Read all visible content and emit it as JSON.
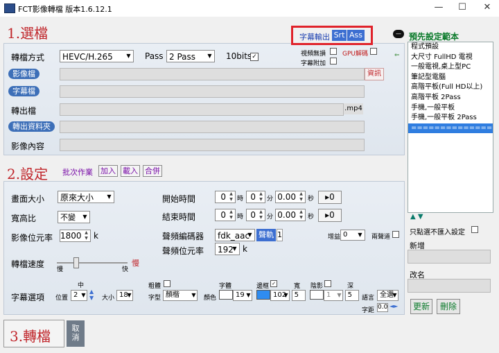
{
  "window": {
    "title": "FCT影像轉檔 版本1.6.12.1",
    "minimize": "—",
    "maximize": "☐",
    "close": "✕"
  },
  "section1": {
    "title": "1.選檔",
    "subtitle_output": "字幕輸出",
    "srt": "Srt",
    "ass": "Ass",
    "format_label": "轉檔方式",
    "format_value": "HEVC/H.265",
    "pass_label": "Pass",
    "pass_value": "2 Pass",
    "bits_label": "10bits",
    "bits_checked": "✓",
    "video_lossless": "視頻無損",
    "gpu_hw": "GPU解碼",
    "subtitle_attach": "字幕附加",
    "video_file": "影像檔",
    "info_button": "資訊",
    "subtitle_file": "字幕檔",
    "output_file": "轉出檔",
    "output_ext": ".mp4",
    "output_folder": "轉出資料夾",
    "video_content": "影像內容"
  },
  "section2": {
    "title": "2.設定",
    "batch": "批次作業",
    "add": "加入",
    "load": "載入",
    "merge": "合併",
    "size_label": "畫面大小",
    "size_value": "原來大小",
    "aspect_label": "寬高比",
    "aspect_value": "不變",
    "bitrate_label": "影像位元率",
    "bitrate_value": "1800",
    "bitrate_unit": "k",
    "speed_label": "轉檔速度",
    "speed_slow": "慢",
    "speed_fast": "快",
    "speed_current": "慢",
    "start_label": "開始時間",
    "end_label": "結束時間",
    "h": "時",
    "m": "分",
    "s": "秒",
    "time_h": "0",
    "time_m": "0",
    "time_s": "0.00",
    "arrow0": "▸0",
    "audio_codec_label": "聲頻編碼器",
    "audio_codec": "fdk_aac",
    "channel": "聲軌",
    "channel_value": "1",
    "gain_label": "增益",
    "gain_value": "0",
    "stereo_label": "兩聲道",
    "audio_bitrate_label": "聲頻位元率",
    "audio_bitrate": "192",
    "audio_bitrate_unit": "k",
    "subtitle_options": "字幕選項",
    "mid": "中",
    "position": "位置",
    "position_value": "2",
    "size2": "大小",
    "size2_value": "18",
    "bold": "粗體",
    "font_label": "字型",
    "font_value": "顏楷",
    "glyph": "字體",
    "color_label": "顏色",
    "color1_value": "19",
    "border": "邊框",
    "border_checked": "✓",
    "color2_value": "102",
    "width": "寬",
    "width_value": "5",
    "shadow": "陰影",
    "shadow_value": "1",
    "depth": "深",
    "depth_value": "5",
    "lang": "語言",
    "lang_value": "全選",
    "spacing": "字距",
    "spacing_value": "0.0"
  },
  "section3": {
    "title": "3.轉檔",
    "cancel": "取消"
  },
  "presets": {
    "title": "預先設定範本",
    "items": [
      "程式預設",
      "大尺寸 FullHD 電視",
      "一般電視,桌上型PC",
      "筆記型電腦",
      "高階平板(Full HD以上)",
      "高階平板 2Pass",
      "手機,一般平板",
      "手機,一般平板  2Pass",
      "=============="
    ],
    "only_not_import": "只點選不匯入設定",
    "add_label": "新增",
    "rename_label": "改名",
    "update": "更新",
    "delete": "刪除"
  }
}
